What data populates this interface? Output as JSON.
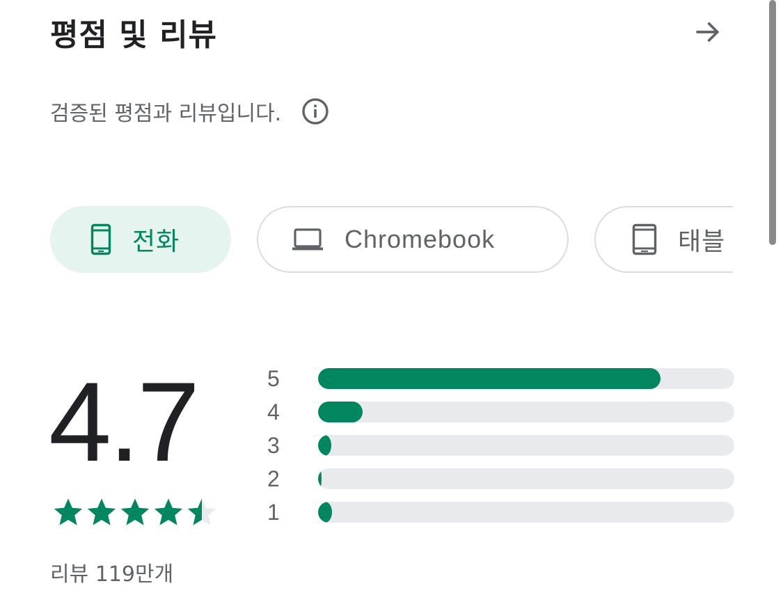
{
  "header": {
    "title": "평점 및 리뷰",
    "arrow_icon": "arrow-right-icon"
  },
  "subtitle": {
    "text": "검증된 평점과 리뷰입니다.",
    "info_icon": "info-icon"
  },
  "device_chips": [
    {
      "label": "전화",
      "icon": "phone-icon",
      "selected": true
    },
    {
      "label": "Chromebook",
      "icon": "laptop-icon",
      "selected": false
    },
    {
      "label": "태블",
      "icon": "tablet-icon",
      "selected": false
    }
  ],
  "rating": {
    "score": "4.7",
    "stars_value": 4.7,
    "stars_max": 5,
    "review_count": "리뷰 119만개"
  },
  "distribution": [
    {
      "stars": "5",
      "fraction": 0.82
    },
    {
      "stars": "4",
      "fraction": 0.107
    },
    {
      "stars": "3",
      "fraction": 0.032
    },
    {
      "stars": "2",
      "fraction": 0.009
    },
    {
      "stars": "1",
      "fraction": 0.033
    }
  ],
  "colors": {
    "accent": "#01875f",
    "chip_selected_bg": "#e6f4ef",
    "track": "#e8eaed",
    "text_primary": "#202124",
    "text_secondary": "#5f6368"
  }
}
